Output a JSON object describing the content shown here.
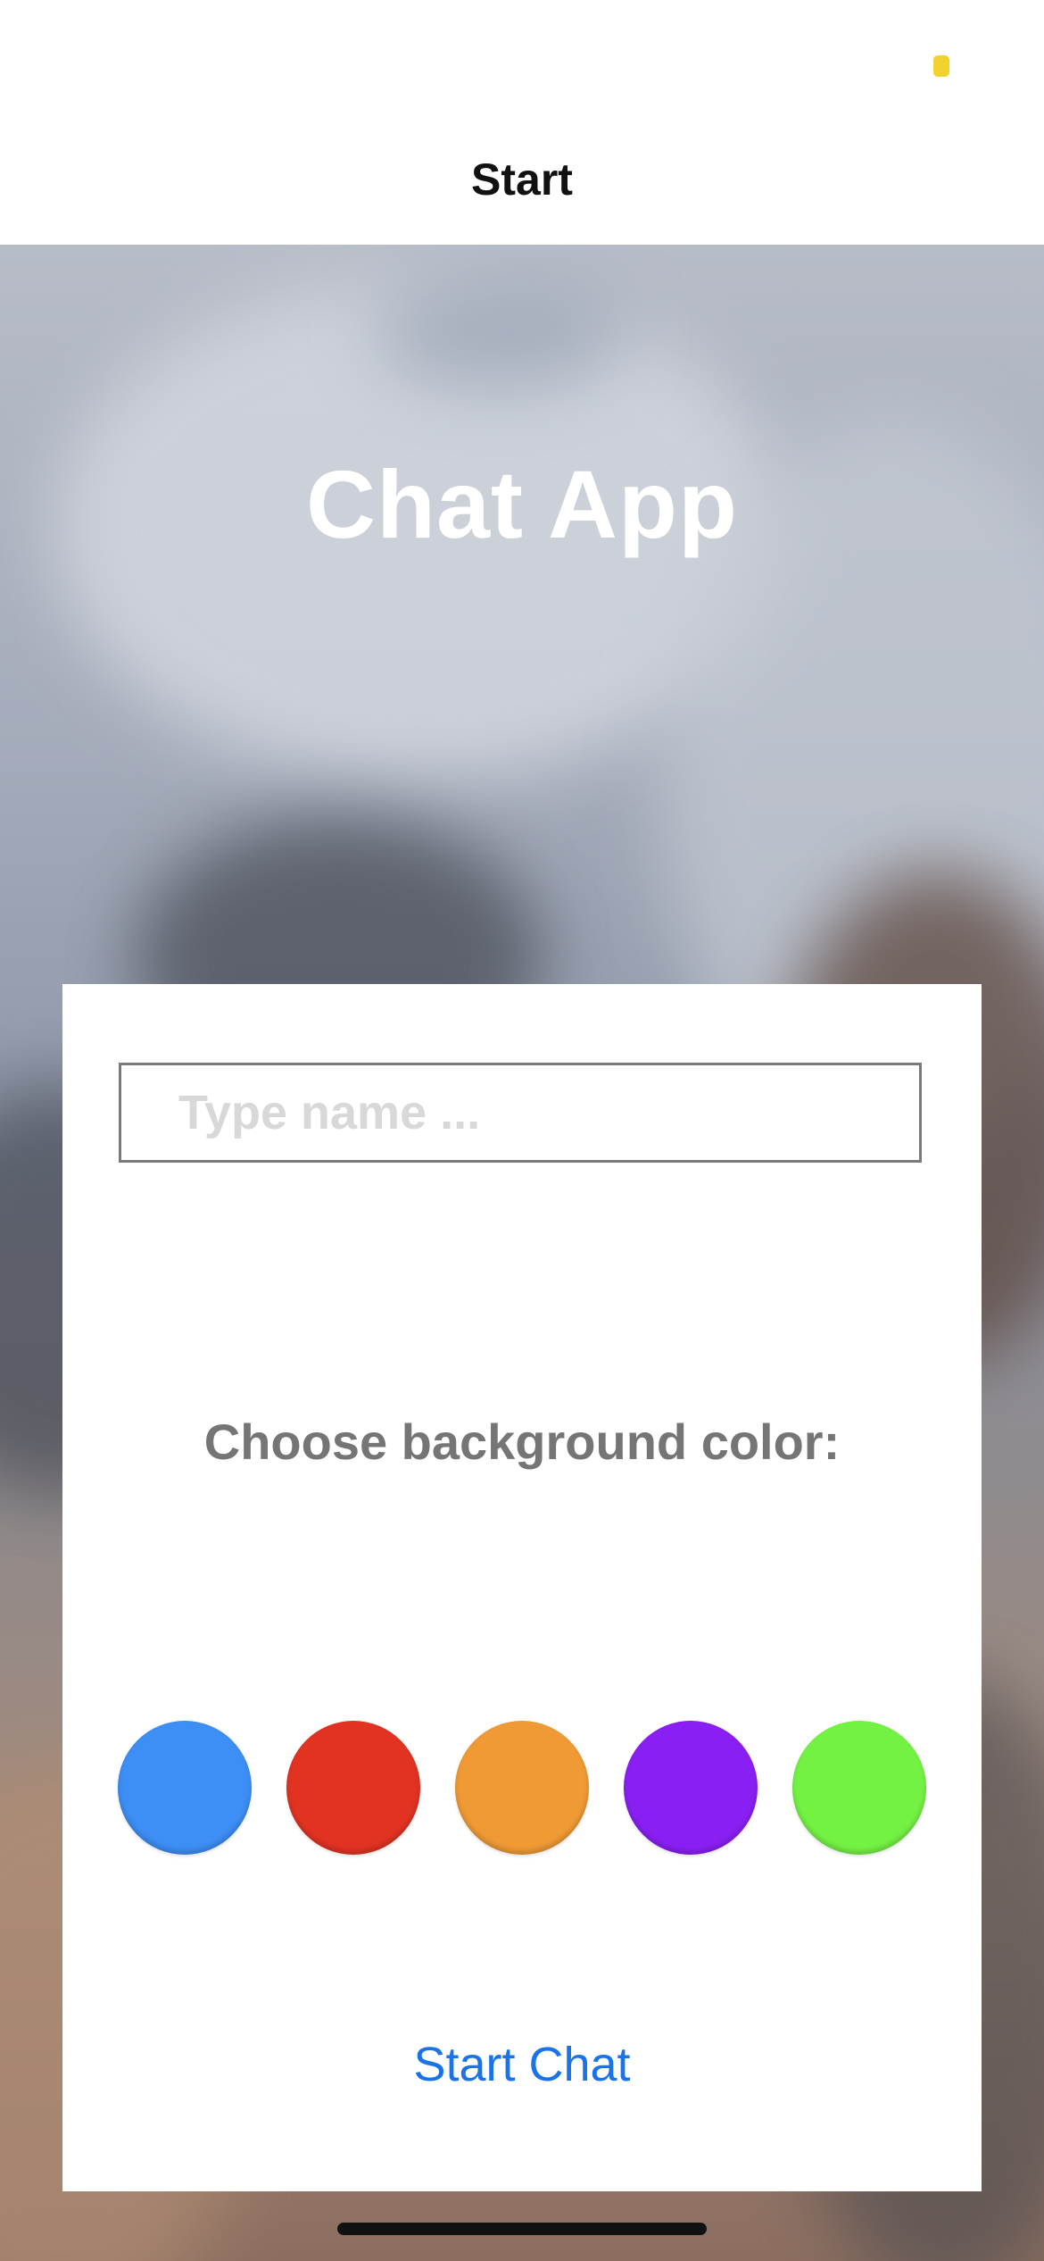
{
  "nav": {
    "title": "Start"
  },
  "app": {
    "title": "Chat App"
  },
  "form": {
    "name_placeholder": "Type name ...",
    "name_value": "",
    "color_label": "Choose background color:",
    "start_label": "Start Chat"
  },
  "colors": [
    {
      "name": "blue",
      "hex": "#3d8ef5"
    },
    {
      "name": "red",
      "hex": "#e23322"
    },
    {
      "name": "orange",
      "hex": "#f09a35"
    },
    {
      "name": "purple",
      "hex": "#8a1ff3"
    },
    {
      "name": "green",
      "hex": "#74f244"
    }
  ],
  "status_bar": {
    "indicator_color": "#f2d22e"
  }
}
